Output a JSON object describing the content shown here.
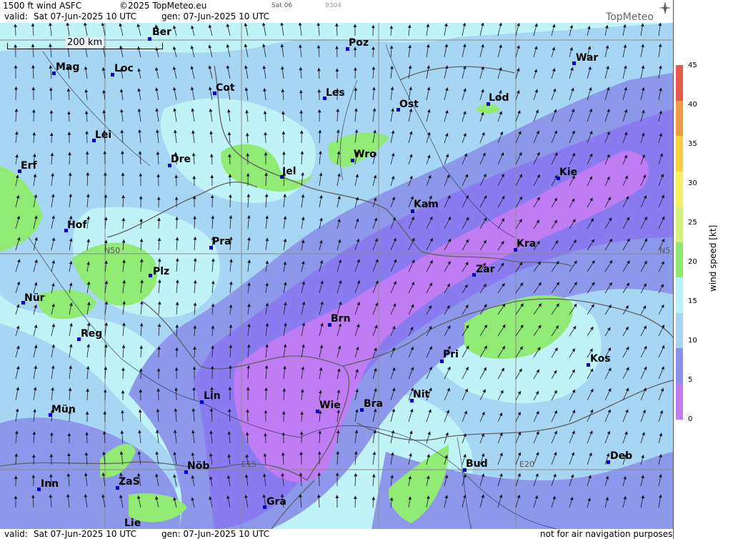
{
  "header": {
    "product": "1500 ft wind ASFC",
    "copyright": "©2025 TopMeteo.eu",
    "valid_label": "valid:",
    "valid_value": "Sat  07-Jun-2025  10 UTC",
    "gen_value": "gen: 07-Jun-2025 10 UTC",
    "day_code": "Sat 06",
    "run_code": "9304",
    "logo_text": "TopMeteo"
  },
  "footer": {
    "valid_label": "valid:",
    "valid_value": "Sat  07-Jun-2025  10 UTC",
    "gen_value": "gen: 07-Jun-2025 10 UTC",
    "disclaimer": "not for air navigation purposes"
  },
  "scale_bar": {
    "label": "200 km"
  },
  "grid_labels": [
    {
      "id": "n50",
      "text": "N50"
    },
    {
      "id": "n50r",
      "text": "N5"
    },
    {
      "id": "e15",
      "text": "E15"
    },
    {
      "id": "e20",
      "text": "E20"
    }
  ],
  "cities": [
    {
      "name": "Ber"
    },
    {
      "name": "Poz"
    },
    {
      "name": "War"
    },
    {
      "name": "Mag"
    },
    {
      "name": "Loc"
    },
    {
      "name": "Cot"
    },
    {
      "name": "Les"
    },
    {
      "name": "Ost"
    },
    {
      "name": "Lod"
    },
    {
      "name": "Lei"
    },
    {
      "name": "Wro"
    },
    {
      "name": "Dre"
    },
    {
      "name": "Erf"
    },
    {
      "name": "Jel"
    },
    {
      "name": "Kie"
    },
    {
      "name": "Kam"
    },
    {
      "name": "Hof"
    },
    {
      "name": "Pra"
    },
    {
      "name": "Kra"
    },
    {
      "name": "Plz"
    },
    {
      "name": "Zar"
    },
    {
      "name": "Nür"
    },
    {
      "name": "Brn"
    },
    {
      "name": "Reg"
    },
    {
      "name": "Pri"
    },
    {
      "name": "Kos"
    },
    {
      "name": "Lin"
    },
    {
      "name": "Nit"
    },
    {
      "name": "Wie"
    },
    {
      "name": "Bra"
    },
    {
      "name": "Mün"
    },
    {
      "name": "Deb"
    },
    {
      "name": "Bud"
    },
    {
      "name": "Nöb"
    },
    {
      "name": "ZaS"
    },
    {
      "name": "Inn"
    },
    {
      "name": "Gra"
    },
    {
      "name": "Lie"
    }
  ],
  "legend": {
    "title": "wind  speed  [kt]",
    "ticks": [
      "45",
      "40",
      "35",
      "30",
      "25",
      "20",
      "15",
      "10",
      "5",
      "0"
    ],
    "colors": [
      "#e8584c",
      "#f09a48",
      "#fbd040",
      "#f8f060",
      "#d4f07c",
      "#8ce870",
      "#b8f2f6",
      "#a8d4f4",
      "#8c90ec",
      "#c07cf0"
    ]
  },
  "colors": {
    "very_light": "#bff3f8",
    "light_blue": "#a6d6f4",
    "mid_blue": "#8e98ea",
    "violet": "#8a7cf0",
    "purple": "#c07cf2",
    "green": "#90ea74",
    "city_dot": "#0000c8",
    "border": "#606060"
  }
}
